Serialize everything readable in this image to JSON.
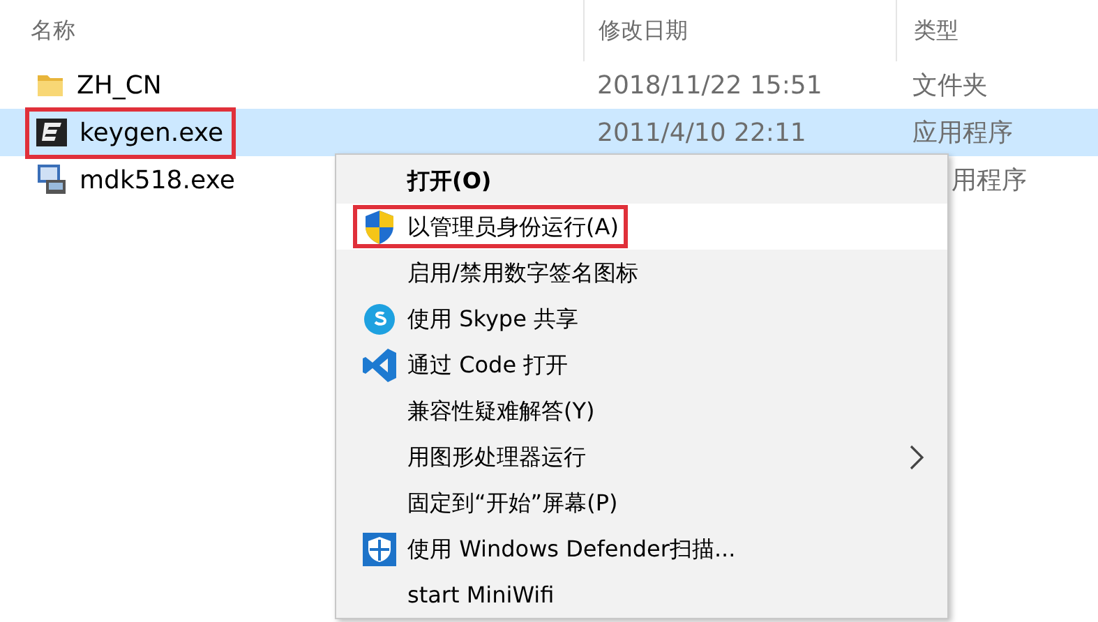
{
  "columns": [
    {
      "label": "名称"
    },
    {
      "label": "修改日期"
    },
    {
      "label": "类型"
    }
  ],
  "files": [
    {
      "kind": "folder",
      "name": "ZH_CN",
      "date": "2018/11/22 15:51",
      "type": "文件夹",
      "selected": false,
      "annotated": false,
      "type_covered": false
    },
    {
      "kind": "keygen",
      "name": "keygen.exe",
      "date": "2011/4/10 22:11",
      "type": "应用程序",
      "selected": true,
      "annotated": true,
      "type_covered": false
    },
    {
      "kind": "installer",
      "name": "mdk518.exe",
      "type": "用程序",
      "selected": false,
      "annotated": false,
      "type_covered": true
    }
  ],
  "context_menu": {
    "items": [
      {
        "label": "打开(O)",
        "bold": true,
        "kind": "plain",
        "submenu": false,
        "highlighted": false,
        "annotated": false
      },
      {
        "label": "以管理员身份运行(A)",
        "bold": false,
        "kind": "shield",
        "submenu": false,
        "highlighted": true,
        "annotated": true
      },
      {
        "label": "启用/禁用数字签名图标",
        "bold": false,
        "kind": "plain",
        "submenu": false,
        "highlighted": false,
        "annotated": false
      },
      {
        "label": "使用 Skype 共享",
        "bold": false,
        "kind": "skype",
        "submenu": false,
        "highlighted": false,
        "annotated": false
      },
      {
        "label": "通过 Code 打开",
        "bold": false,
        "kind": "code",
        "submenu": false,
        "highlighted": false,
        "annotated": false
      },
      {
        "label": "兼容性疑难解答(Y)",
        "bold": false,
        "kind": "plain",
        "submenu": false,
        "highlighted": false,
        "annotated": false
      },
      {
        "label": "用图形处理器运行",
        "bold": false,
        "kind": "plain",
        "submenu": true,
        "highlighted": false,
        "annotated": false
      },
      {
        "label": "固定到“开始”屏幕(P)",
        "bold": false,
        "kind": "plain",
        "submenu": false,
        "highlighted": false,
        "annotated": false
      },
      {
        "label": "使用 Windows Defender扫描...",
        "bold": false,
        "kind": "defender",
        "submenu": false,
        "highlighted": false,
        "annotated": false
      },
      {
        "label": "start MiniWifi",
        "bold": false,
        "kind": "plain",
        "submenu": false,
        "highlighted": false,
        "annotated": false
      }
    ]
  }
}
